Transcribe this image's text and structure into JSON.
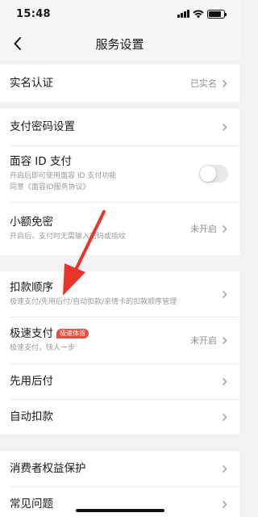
{
  "status_bar": {
    "time": "15:48",
    "battery_level": 0.85
  },
  "header": {
    "title": "服务设置"
  },
  "groups": [
    [
      {
        "title": "实名认证",
        "value": "已实名"
      }
    ],
    [
      {
        "title": "支付密码设置"
      },
      {
        "title": "面容 ID 支付",
        "subtitle_line1": "开启后即可使用面容 ID 支付功能",
        "subtitle_line2": "同意《面容ID服务协议》",
        "toggle_on": false
      },
      {
        "title": "小额免密",
        "subtitle": "开启后，支付时无需输入密码或指纹",
        "value": "未开启"
      }
    ],
    [
      {
        "title": "扣款顺序",
        "subtitle": "极速支付/先用后付/自动扣款/亲情卡的扣款顺序管理"
      },
      {
        "title": "极速支付",
        "badge": "极速体验",
        "subtitle": "极速支付，快人一步",
        "value": "未开启"
      },
      {
        "title": "先用后付"
      },
      {
        "title": "自动扣款"
      }
    ],
    [
      {
        "title": "消费者权益保护"
      },
      {
        "title": "常见问题"
      }
    ]
  ],
  "colors": {
    "accent_red": "#e94b3c",
    "background": "#f2f2f4"
  },
  "icons": {
    "back": "chevron-left-icon",
    "row_arrow": "chevron-right-icon",
    "annotation": "red-arrow-annotation"
  }
}
